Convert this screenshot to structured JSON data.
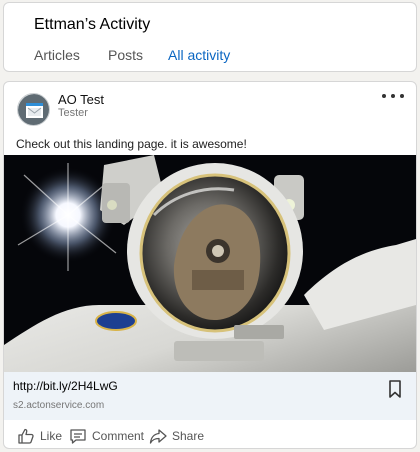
{
  "activity": {
    "title": "Ettman’s Activity",
    "tabs": [
      {
        "label": "Articles",
        "active": false
      },
      {
        "label": "Posts",
        "active": false
      },
      {
        "label": "All activity",
        "active": true
      }
    ]
  },
  "post": {
    "author": {
      "name": "AO Test",
      "subtitle": "Tester",
      "avatar_icon": "envelope-icon"
    },
    "more_icon": "ellipsis-icon",
    "text": "Check out this landing page. it is awesome!",
    "image_icon": "astronaut-photo",
    "link": {
      "url": "http://bit.ly/2H4LwG",
      "domain": "s2.actonservice.com",
      "bookmark_icon": "bookmark-icon"
    },
    "actions": [
      {
        "label": "Like",
        "icon": "thumbs-up-icon"
      },
      {
        "label": "Comment",
        "icon": "comment-icon"
      },
      {
        "label": "Share",
        "icon": "share-arrow-icon"
      }
    ]
  },
  "colors": {
    "accent": "#0a66c2",
    "background": "#f3f2ef",
    "link_bar": "#eef3f8"
  }
}
